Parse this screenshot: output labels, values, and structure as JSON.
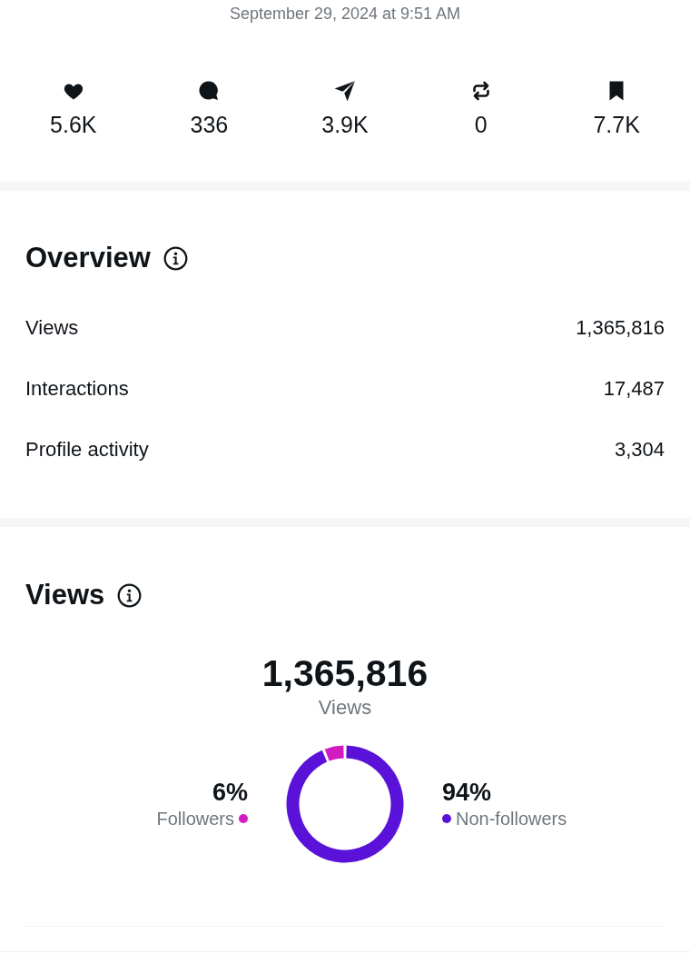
{
  "timestamp": "September 29, 2024 at 9:51 AM",
  "engagement": [
    {
      "kind": "likes",
      "count": "5.6K"
    },
    {
      "kind": "comments",
      "count": "336"
    },
    {
      "kind": "shares",
      "count": "3.9K"
    },
    {
      "kind": "reposts",
      "count": "0"
    },
    {
      "kind": "bookmarks",
      "count": "7.7K"
    }
  ],
  "overview": {
    "title": "Overview",
    "metrics": [
      {
        "label": "Views",
        "value": "1,365,816"
      },
      {
        "label": "Interactions",
        "value": "17,487"
      },
      {
        "label": "Profile activity",
        "value": "3,304"
      }
    ]
  },
  "views": {
    "title": "Views",
    "total": "1,365,816",
    "total_label": "Views",
    "chart_data": {
      "type": "donut",
      "categories": [
        "Followers",
        "Non-followers"
      ],
      "values": [
        6,
        94
      ],
      "colors": [
        "#d31bc4",
        "#5a12d9"
      ],
      "value_labels": [
        "6%",
        "94%"
      ]
    }
  }
}
